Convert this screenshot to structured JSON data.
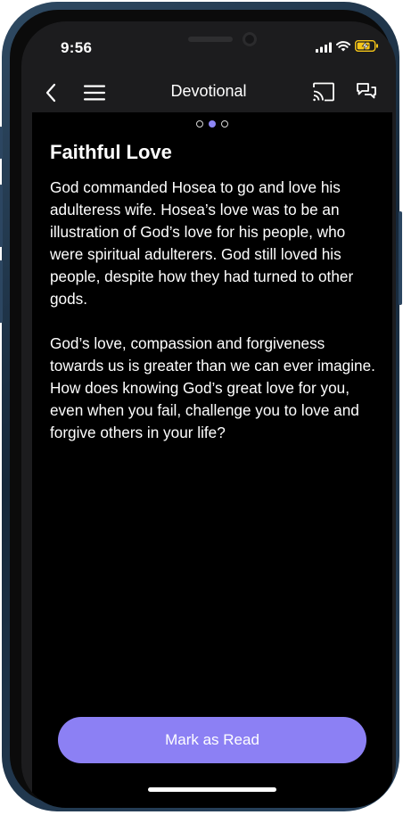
{
  "status_bar": {
    "time": "9:56",
    "icons": [
      "signal-icon",
      "wifi-icon",
      "battery-charging-icon"
    ],
    "battery_color": "#f5c518"
  },
  "nav": {
    "title": "Devotional",
    "back_icon": "chevron-left-icon",
    "menu_icon": "hamburger-menu-icon",
    "cast_icon": "cast-icon",
    "chat_icon": "chat-bubbles-icon"
  },
  "pager": {
    "total": 3,
    "active_index": 1
  },
  "devotional": {
    "title": "Faithful Love",
    "paragraphs": [
      "God commanded Hosea to go and love his adulteress wife. Hosea’s love was to be an illustration of God’s love for his people, who were spiritual adulterers. God still loved his people, despite how they had turned to other gods.",
      "God’s love, compassion and forgiveness towards us is greater than we can ever imagine. How does knowing God’s great love for you, even when you fail, challenge you to love and forgive others in your life?"
    ]
  },
  "actions": {
    "mark_read_label": "Mark as Read"
  },
  "colors": {
    "accent": "#8c80f4",
    "background": "#000000",
    "nav_background": "#1c1c1e",
    "text": "#ffffff"
  }
}
